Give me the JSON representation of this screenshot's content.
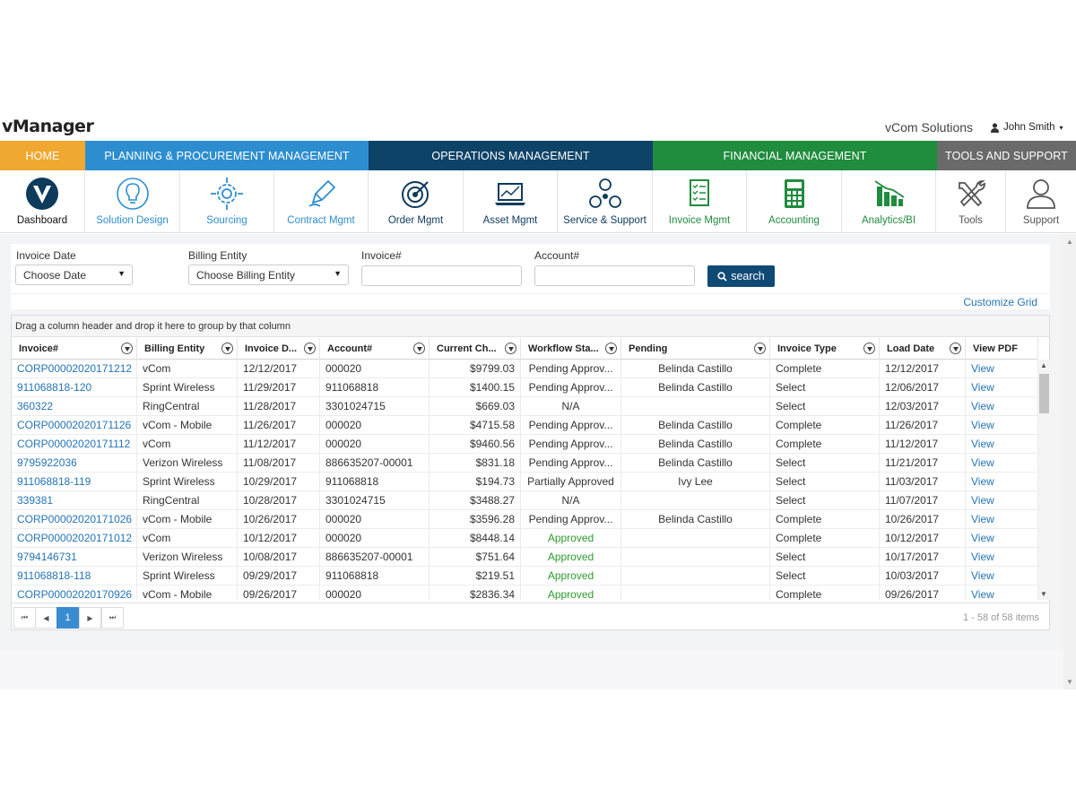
{
  "header": {
    "logo": "vManager",
    "company": "vCom Solutions",
    "user": "John Smith",
    "user_caret": "▾"
  },
  "nav_tabs": [
    {
      "label": "HOME",
      "color": "#f0a830"
    },
    {
      "label": "PLANNING & PROCUREMENT MANAGEMENT",
      "color": "#2d8ecf"
    },
    {
      "label": "OPERATIONS MANAGEMENT",
      "color": "#0e4368"
    },
    {
      "label": "FINANCIAL MANAGEMENT",
      "color": "#1f8c3e"
    },
    {
      "label": "TOOLS AND SUPPORT",
      "color": "#6a6a6a"
    }
  ],
  "modules": [
    {
      "label": "Dashboard",
      "icon": "dashboard-icon"
    },
    {
      "label": "Solution Design",
      "icon": "lightbulb-icon"
    },
    {
      "label": "Sourcing",
      "icon": "sourcing-gear-icon"
    },
    {
      "label": "Contract Mgmt",
      "icon": "pen-icon"
    },
    {
      "label": "Order Mgmt",
      "icon": "target-icon"
    },
    {
      "label": "Asset Mgmt",
      "icon": "laptop-icon"
    },
    {
      "label": "Service & Support",
      "icon": "network-icon"
    },
    {
      "label": "Invoice Mgmt",
      "icon": "invoice-icon"
    },
    {
      "label": "Accounting",
      "icon": "calculator-icon"
    },
    {
      "label": "Analytics/BI",
      "icon": "analytics-icon"
    },
    {
      "label": "Tools",
      "icon": "tools-icon"
    },
    {
      "label": "Support",
      "icon": "support-user-icon"
    }
  ],
  "filters": {
    "invoice_date_label": "Invoice Date",
    "invoice_date_value": "Choose Date",
    "billing_entity_label": "Billing Entity",
    "billing_entity_value": "Choose Billing Entity",
    "invoice_num_label": "Invoice#",
    "invoice_num_value": "",
    "account_num_label": "Account#",
    "account_num_value": "",
    "search_label": "search"
  },
  "customize_grid": "Customize Grid",
  "grid": {
    "group_hint": "Drag a column header and drop it here to group by that column",
    "columns": [
      "Invoice#",
      "Billing Entity",
      "Invoice D...",
      "Account#",
      "Current Ch...",
      "Workflow Sta...",
      "Pending",
      "Invoice Type",
      "Load Date",
      "View PDF"
    ],
    "rows": [
      [
        "CORP00002020171212",
        "vCom",
        "12/12/2017",
        "000020",
        "$9799.03",
        "Pending Approv...",
        "Belinda Castillo",
        "Complete",
        "12/12/2017",
        "View"
      ],
      [
        "911068818-120",
        "Sprint Wireless",
        "11/29/2017",
        "911068818",
        "$1400.15",
        "Pending Approv...",
        "Belinda Castillo",
        "Select",
        "12/06/2017",
        "View"
      ],
      [
        "360322",
        "RingCentral",
        "11/28/2017",
        "3301024715",
        "$669.03",
        "N/A",
        "",
        "Select",
        "12/03/2017",
        "View"
      ],
      [
        "CORP00002020171126",
        "vCom - Mobile",
        "11/26/2017",
        "000020",
        "$4715.58",
        "Pending Approv...",
        "Belinda Castillo",
        "Complete",
        "11/26/2017",
        "View"
      ],
      [
        "CORP00002020171112",
        "vCom",
        "11/12/2017",
        "000020",
        "$9460.56",
        "Pending Approv...",
        "Belinda Castillo",
        "Complete",
        "11/12/2017",
        "View"
      ],
      [
        "9795922036",
        "Verizon Wireless",
        "11/08/2017",
        "886635207-00001",
        "$831.18",
        "Pending Approv...",
        "Belinda Castillo",
        "Select",
        "11/21/2017",
        "View"
      ],
      [
        "911068818-119",
        "Sprint Wireless",
        "10/29/2017",
        "911068818",
        "$194.73",
        "Partially Approved",
        "Ivy Lee",
        "Select",
        "11/03/2017",
        "View"
      ],
      [
        "339381",
        "RingCentral",
        "10/28/2017",
        "3301024715",
        "$3488.27",
        "N/A",
        "",
        "Select",
        "11/07/2017",
        "View"
      ],
      [
        "CORP00002020171026",
        "vCom - Mobile",
        "10/26/2017",
        "000020",
        "$3596.28",
        "Pending Approv...",
        "Belinda Castillo",
        "Complete",
        "10/26/2017",
        "View"
      ],
      [
        "CORP00002020171012",
        "vCom",
        "10/12/2017",
        "000020",
        "$8448.14",
        "Approved",
        "",
        "Complete",
        "10/12/2017",
        "View"
      ],
      [
        "9794146731",
        "Verizon Wireless",
        "10/08/2017",
        "886635207-00001",
        "$751.64",
        "Approved",
        "",
        "Select",
        "10/17/2017",
        "View"
      ],
      [
        "911068818-118",
        "Sprint Wireless",
        "09/29/2017",
        "911068818",
        "$219.51",
        "Approved",
        "",
        "Select",
        "10/03/2017",
        "View"
      ],
      [
        "CORP00002020170926",
        "vCom - Mobile",
        "09/26/2017",
        "000020",
        "$2836.34",
        "Approved",
        "",
        "Complete",
        "09/26/2017",
        "View"
      ]
    ]
  },
  "pager": {
    "first": "⏮",
    "prev": "◀",
    "current_page": "1",
    "next": "▶",
    "last": "⏭",
    "info": "1 - 58 of 58 items"
  },
  "colors": {
    "link": "#2574b5",
    "approved": "#2e9a2e",
    "search_button": "#0f4a75",
    "active_page": "#3a8cd0"
  }
}
